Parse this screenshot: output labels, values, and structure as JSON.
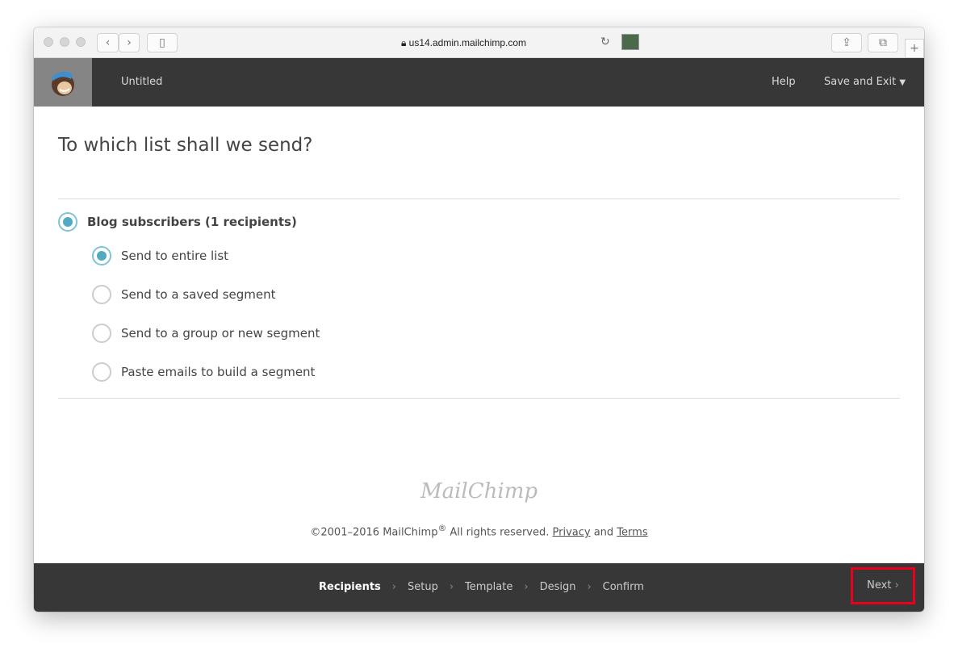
{
  "browser": {
    "url": "us14.admin.mailchimp.com"
  },
  "header": {
    "title": "Untitled",
    "help": "Help",
    "save_exit": "Save and Exit"
  },
  "main": {
    "heading": "To which list shall we send?",
    "list": {
      "label": "Blog subscribers (1 recipients)",
      "selected": true
    },
    "options": [
      {
        "label": "Send to entire list",
        "selected": true
      },
      {
        "label": "Send to a saved segment",
        "selected": false
      },
      {
        "label": "Send to a group or new segment",
        "selected": false
      },
      {
        "label": "Paste emails to build a segment",
        "selected": false
      }
    ]
  },
  "footer": {
    "brand": "MailChimp",
    "copyright": "©2001–2016 MailChimp",
    "reg": "®",
    "rights": " All rights reserved. ",
    "privacy": "Privacy",
    "and": " and ",
    "terms": "Terms"
  },
  "steps": [
    {
      "label": "Recipients",
      "current": true
    },
    {
      "label": "Setup"
    },
    {
      "label": "Template"
    },
    {
      "label": "Design"
    },
    {
      "label": "Confirm"
    }
  ],
  "next": "Next",
  "colors": {
    "accent": "#52a9c4",
    "highlight": "#e8001c",
    "bar": "#373737"
  }
}
